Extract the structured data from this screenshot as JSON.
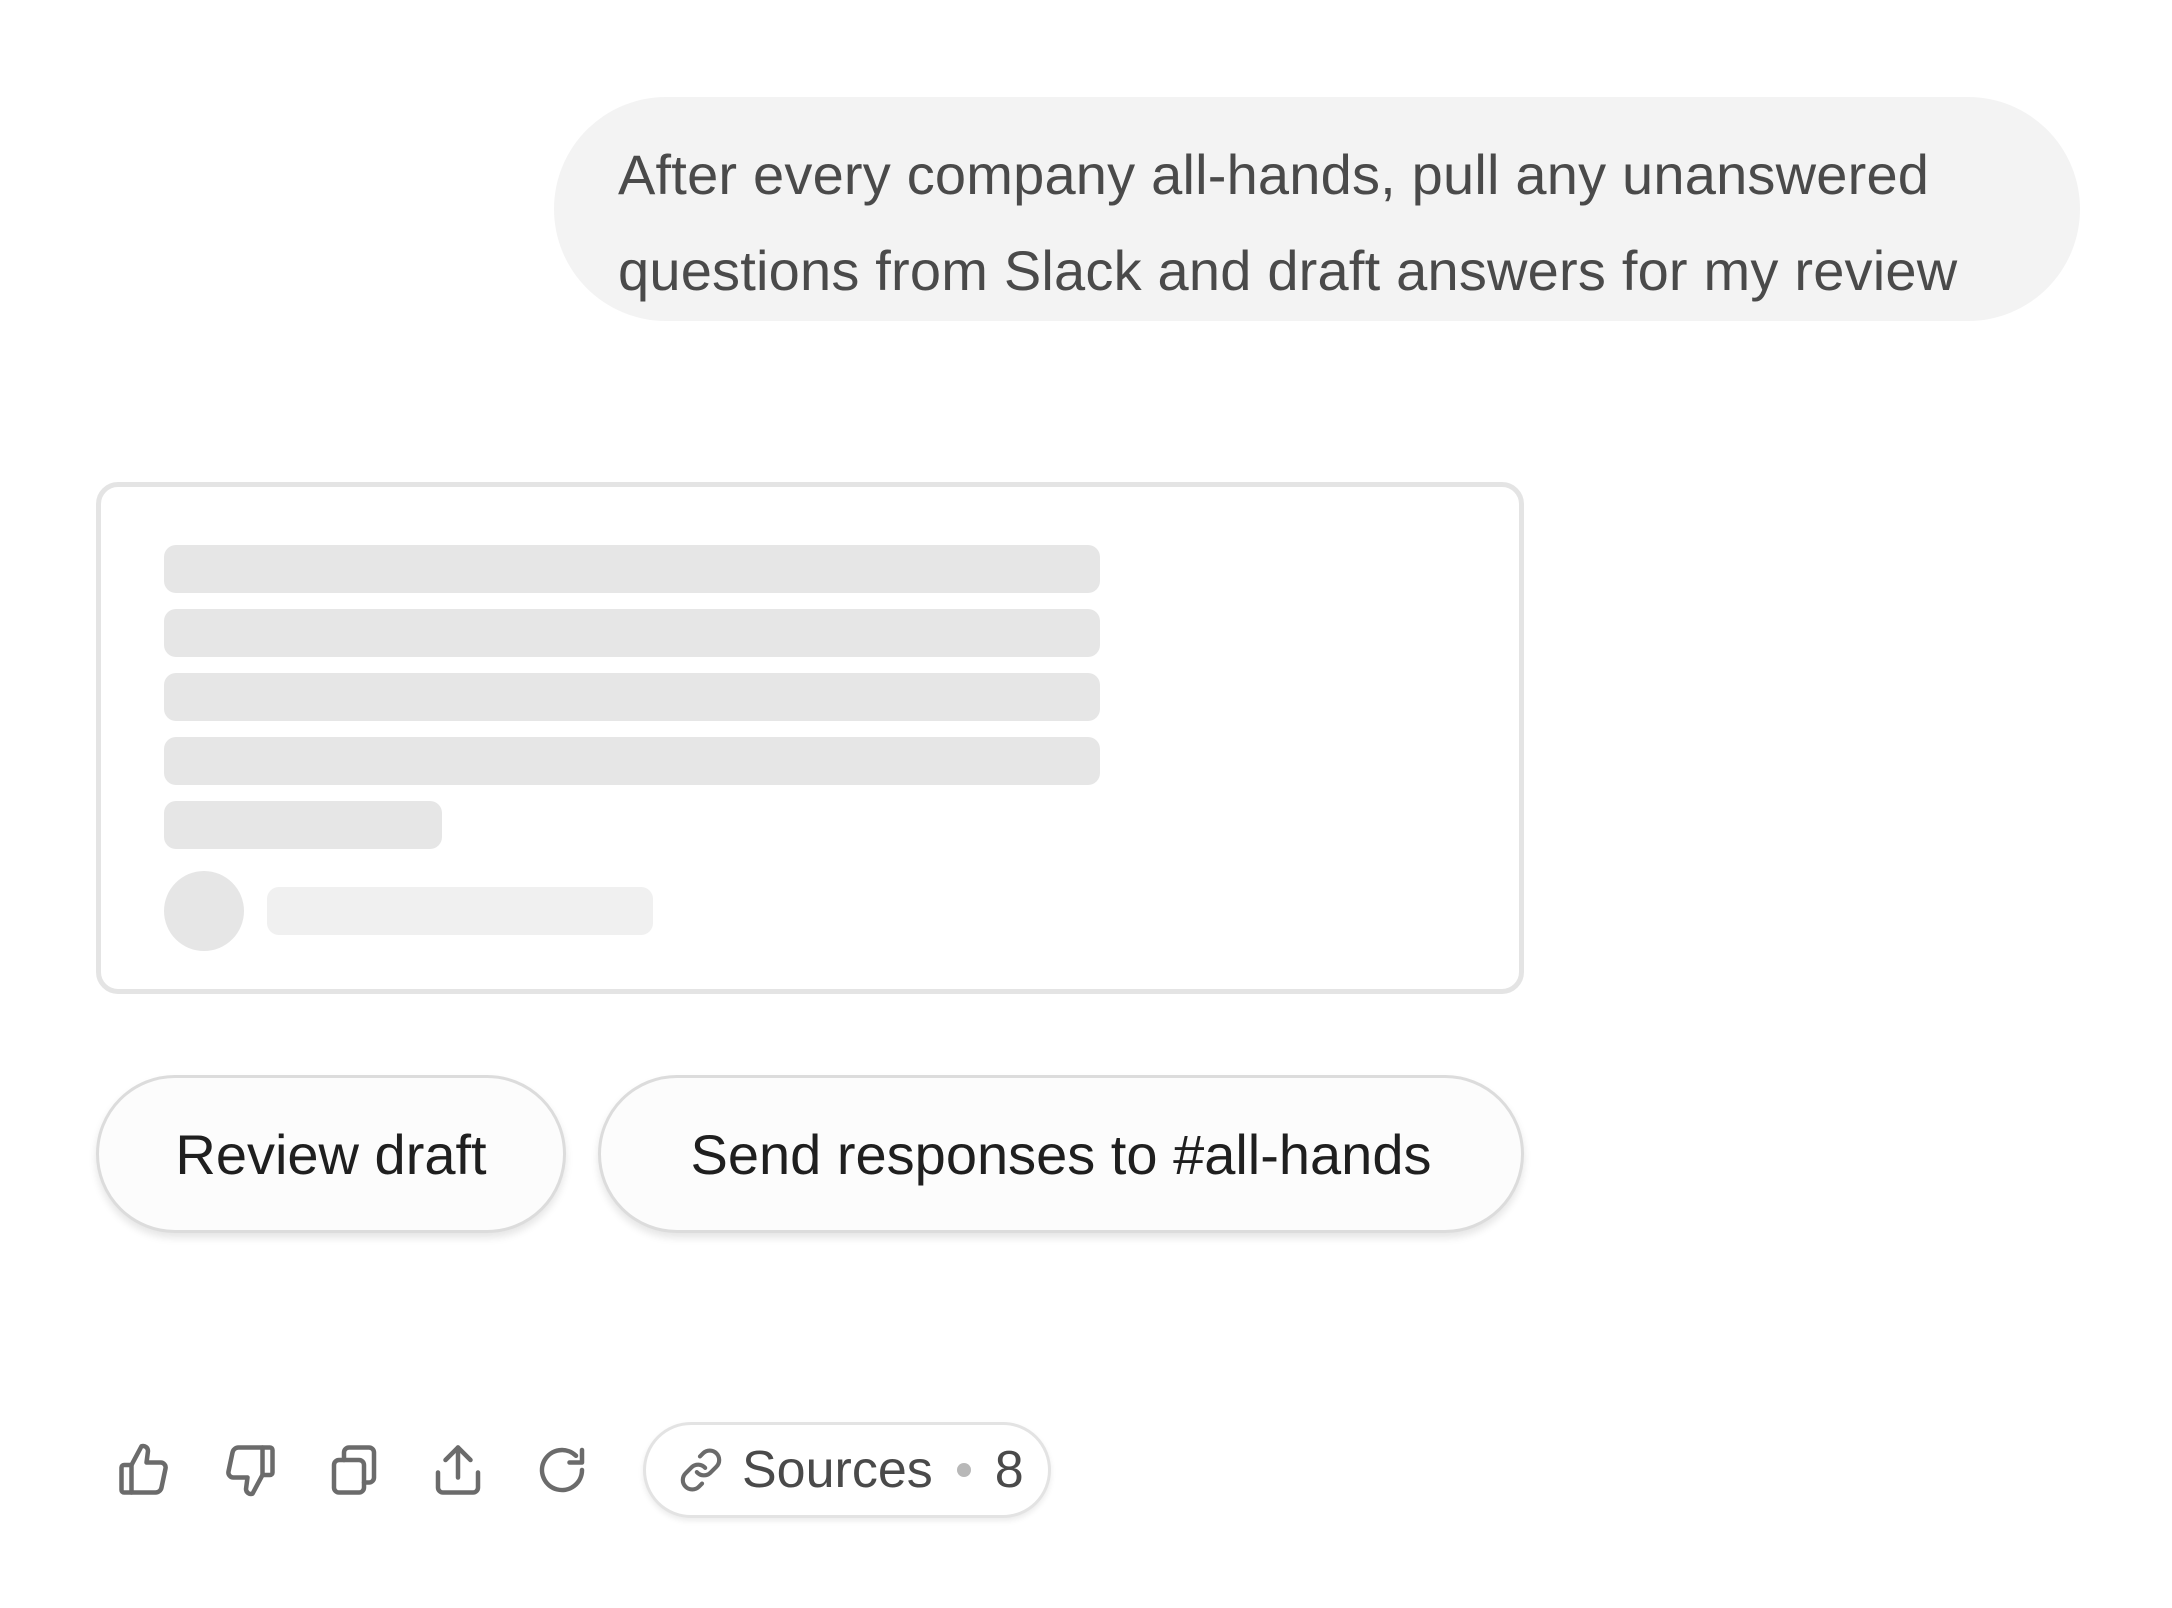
{
  "conversation": {
    "user_message": "After every company all-hands, pull any unanswered questions from Slack and draft answers for my review"
  },
  "actions": {
    "review_label": "Review draft",
    "send_label": "Send responses to #all-hands"
  },
  "toolbar": {
    "icons": [
      "thumbs-up-icon",
      "thumbs-down-icon",
      "copy-icon",
      "share-icon",
      "retry-icon"
    ],
    "sources_label": "Sources",
    "sources_count": "8"
  },
  "colors": {
    "bubble_bg": "#f3f3f3",
    "skeleton": "#e6e6e6",
    "border": "#e4e4e4",
    "text": "#1f1f1f",
    "muted": "#6b6b6b"
  }
}
